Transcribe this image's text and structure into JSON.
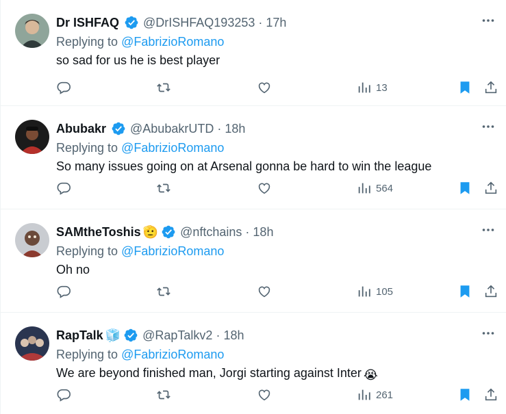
{
  "reply_prefix": "Replying to",
  "tweets": [
    {
      "name": "Dr ISHFAQ",
      "name_emoji": "",
      "handle": "@DrISHFAQ193253",
      "dot": "·",
      "time": "17h",
      "mention": "@FabrizioRomano",
      "text": "so sad for us he is best player",
      "text_emoji": "",
      "views": "13",
      "avatar_colors": [
        "#7a8a7e",
        "#c9b9a3"
      ]
    },
    {
      "name": "Abubakr",
      "name_emoji": "",
      "handle": "@AbubakrUTD",
      "dot": "·",
      "time": "18h",
      "mention": "@FabrizioRomano",
      "text": "So many issues going on at Arsenal gonna be hard to win the league",
      "text_emoji": "",
      "views": "564",
      "avatar_colors": [
        "#1b1b1b",
        "#b5302a"
      ]
    },
    {
      "name": "SAMtheToshis",
      "name_emoji": "🫡",
      "handle": "@nftchains",
      "dot": "·",
      "time": "18h",
      "mention": "@FabrizioRomano",
      "text": "Oh no",
      "text_emoji": "",
      "views": "105",
      "avatar_colors": [
        "#c9ccd1",
        "#8b3a2e"
      ]
    },
    {
      "name": "RapTalk",
      "name_emoji": "🧊",
      "handle": "@RapTalkv2",
      "dot": "·",
      "time": "18h",
      "mention": "@FabrizioRomano",
      "text": "We are beyond finished man, Jorgi starting against Inter",
      "text_emoji": "😭",
      "views": "261",
      "avatar_colors": [
        "#2a3550",
        "#b03a3a"
      ]
    }
  ],
  "colors": {
    "accent": "#1d9bf0",
    "secondary_text": "#536471",
    "primary_text": "#0f1419",
    "divider": "#eff3f4"
  },
  "icons": [
    "verified-badge-icon",
    "more-icon",
    "reply-icon",
    "retweet-icon",
    "like-icon",
    "views-icon",
    "bookmark-icon",
    "share-icon"
  ]
}
